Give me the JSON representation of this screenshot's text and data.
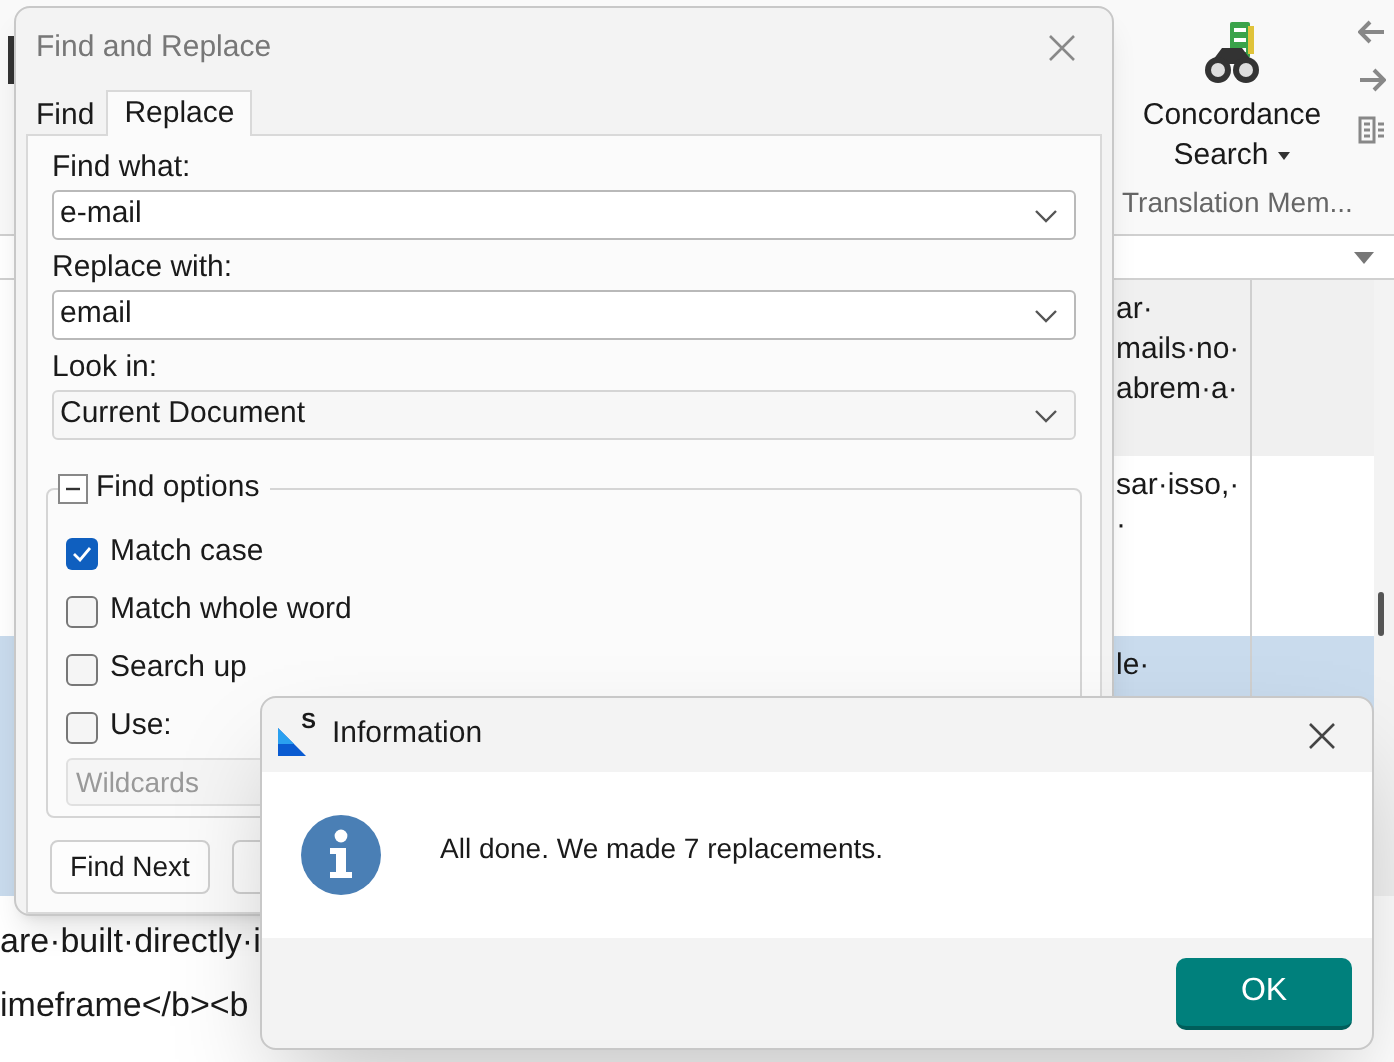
{
  "app": {
    "ribbon": {
      "concordance_search": {
        "label": "Concordance",
        "sublabel": "Search"
      },
      "group_label": "Translation Mem..."
    },
    "editor": {
      "rows": [
        {
          "selected": false,
          "target_lines": [
            "ar·",
            "mails·no·",
            "abrem·a·"
          ]
        },
        {
          "selected": false,
          "target_lines": [
            "sar·isso,·",
            "·"
          ]
        },
        {
          "selected": true,
          "target_lines": [
            "le·"
          ]
        },
        {
          "selected": false,
          "source_lines": [
            "are·built·directly·i"
          ]
        },
        {
          "selected": false,
          "source_lines": [
            "imeframe</b><b"
          ]
        }
      ]
    }
  },
  "find_dialog": {
    "title": "Find and Replace",
    "tabs": [
      {
        "label": "Find",
        "selected": false
      },
      {
        "label": "Replace",
        "selected": true
      }
    ],
    "find_what": {
      "label": "Find what:",
      "value": "e-mail"
    },
    "replace_with": {
      "label": "Replace with:",
      "value": "email"
    },
    "look_in": {
      "label": "Look in:",
      "value": "Current Document"
    },
    "find_options": {
      "label": "Find options",
      "expanded": true,
      "options": [
        {
          "label": "Match case",
          "checked": true
        },
        {
          "label": "Match whole word",
          "checked": false
        },
        {
          "label": "Search up",
          "checked": false
        },
        {
          "label": "Use:",
          "checked": false
        }
      ],
      "use_mode": {
        "value": "Wildcards",
        "disabled": true
      }
    },
    "buttons": [
      "Find Next"
    ]
  },
  "info_dialog": {
    "logo_letter": "S",
    "title": "Information",
    "message": "All done. We made 7 replacements.",
    "button": "OK"
  }
}
